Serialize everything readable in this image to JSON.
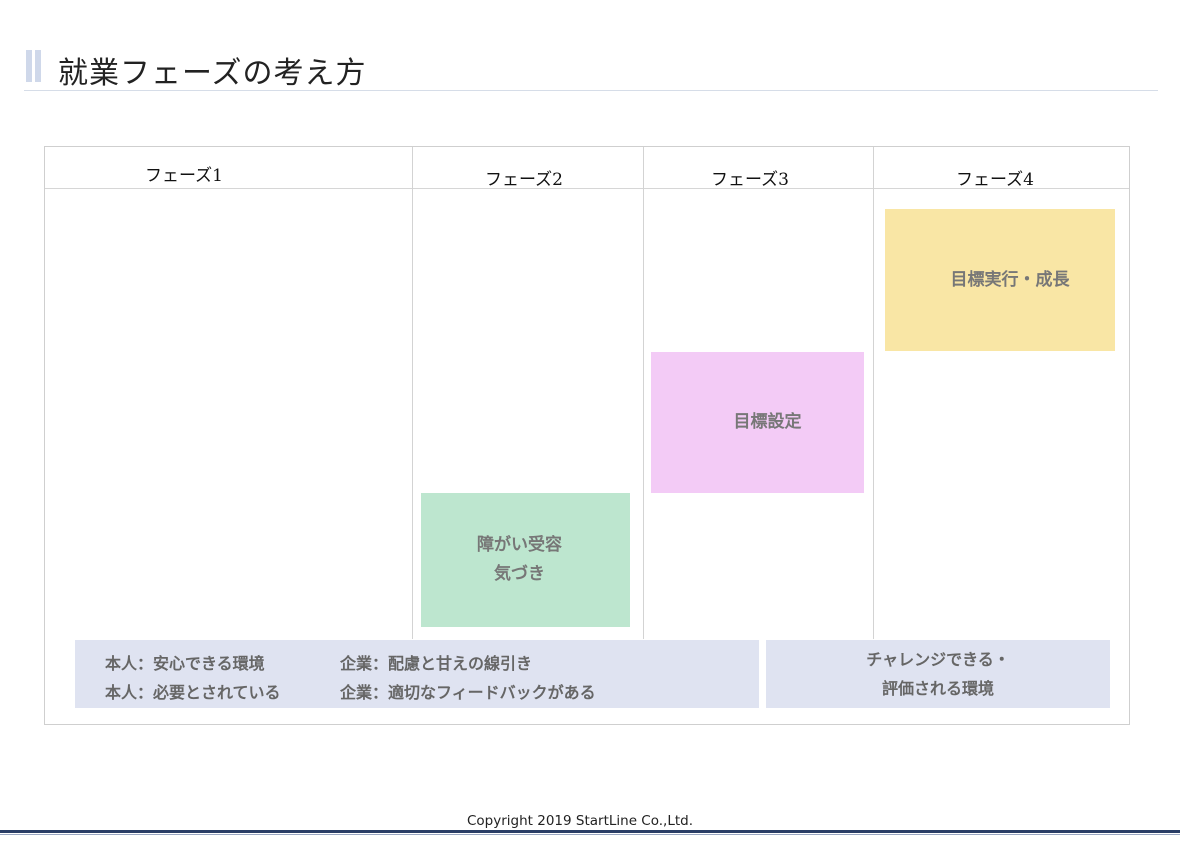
{
  "slide": {
    "title": "就業フェーズの考え方",
    "copyright": "Copyright 2019 StartLine Co.,Ltd."
  },
  "phases": [
    {
      "label": "フェーズ1"
    },
    {
      "label": "フェーズ2"
    },
    {
      "label": "フェーズ3"
    },
    {
      "label": "フェーズ4"
    }
  ],
  "boxes": {
    "phase2": {
      "line1": "障がい受容",
      "line2": "気づき",
      "color": "#bde6cf"
    },
    "phase3": {
      "label": "目標設定",
      "color": "#f3cbf6"
    },
    "phase4": {
      "label": "目標実行・成長",
      "color": "#f9e6a5"
    }
  },
  "environment": {
    "left": {
      "row1_person": "本人：安心できる環境",
      "row1_company": "企業：配慮と甘えの線引き",
      "row2_person": "本人：必要とされている",
      "row2_company": "企業：適切なフィードバックがある"
    },
    "right": {
      "line1": "チャレンジできる・",
      "line2": "評価される環境"
    },
    "color": "#dfe3f1"
  }
}
